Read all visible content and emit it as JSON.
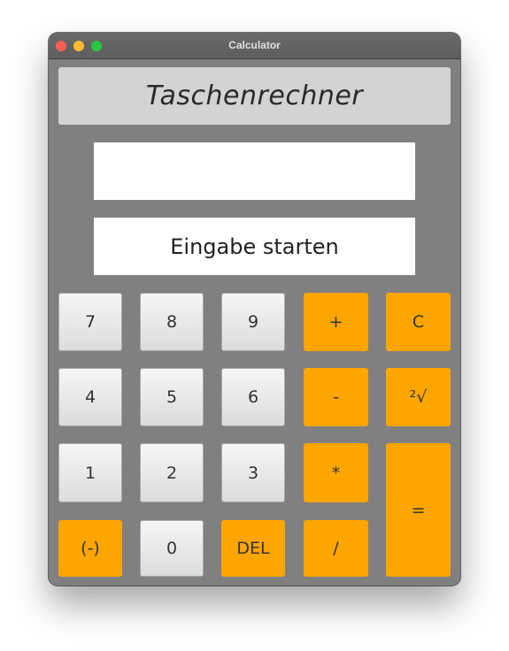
{
  "window": {
    "title": "Calculator"
  },
  "header": {
    "title": "Taschenrechner"
  },
  "input_field": {
    "value": ""
  },
  "output_field": {
    "value": "Eingabe starten"
  },
  "colors": {
    "window_bg": "#808080",
    "header_bg": "#d3d3d3",
    "operator_bg": "#ffa500",
    "number_bg": "#ececec"
  },
  "buttons": {
    "seven": "7",
    "eight": "8",
    "nine": "9",
    "plus": "+",
    "clear": "C",
    "four": "4",
    "five": "5",
    "six": "6",
    "minus": "-",
    "sqrt": "²√",
    "one": "1",
    "two": "2",
    "three": "3",
    "multiply": "*",
    "equals": "=",
    "negate": "(-)",
    "zero": "0",
    "delete": "DEL",
    "divide": "/"
  }
}
